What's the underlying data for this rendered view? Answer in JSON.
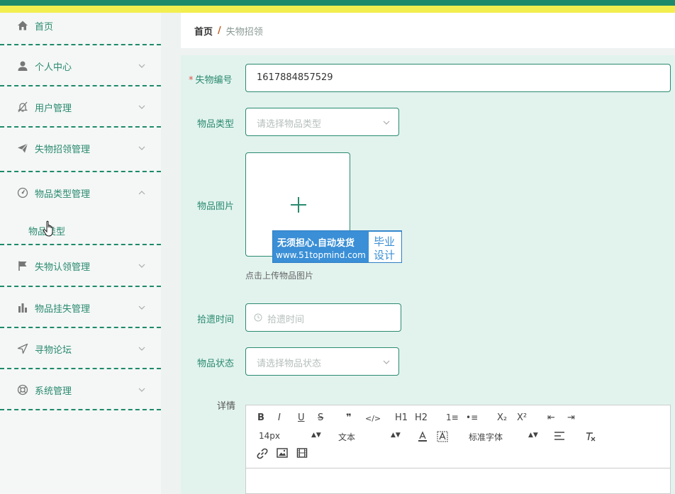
{
  "colors": {
    "primary": "#2a8a6f",
    "topbar_green": "#1e8a6a",
    "topbar_yellow": "#f2ee4f",
    "main_bg": "#e2f3ee",
    "required": "#e0534a",
    "watermark": "#3a8fd6"
  },
  "sidebar": {
    "items": [
      {
        "label": "首页",
        "icon": "home-icon"
      },
      {
        "label": "个人中心",
        "icon": "user-icon"
      },
      {
        "label": "用户管理",
        "icon": "bell-off-icon"
      },
      {
        "label": "失物招领管理",
        "icon": "send-icon"
      },
      {
        "label": "物品类型管理",
        "icon": "dashboard-icon"
      },
      {
        "label": "失物认领管理",
        "icon": "flag-icon"
      },
      {
        "label": "物品挂失管理",
        "icon": "bar-chart-icon"
      },
      {
        "label": "寻物论坛",
        "icon": "navigation-icon"
      },
      {
        "label": "系统管理",
        "icon": "lifebuoy-icon"
      }
    ],
    "submenu": {
      "label": "物品类型"
    }
  },
  "breadcrumb": {
    "home": "首页",
    "separator": "/",
    "current": "失物招领"
  },
  "form": {
    "lost_no": {
      "label": "失物编号",
      "value": "1617884857529"
    },
    "item_type": {
      "label": "物品类型",
      "placeholder": "请选择物品类型"
    },
    "item_image": {
      "label": "物品图片",
      "tip": "点击上传物品图片"
    },
    "found_time": {
      "label": "拾遗时间",
      "placeholder": "拾遗时间"
    },
    "item_status": {
      "label": "物品状态",
      "placeholder": "请选择物品状态"
    },
    "details": {
      "label": "详情"
    }
  },
  "editor": {
    "font_size": "14px",
    "header_select": "文本",
    "font_family": "标准字体",
    "buttons": [
      "B",
      "I",
      "U",
      "S",
      "❞",
      "</>",
      "H1",
      "H2",
      "1≡",
      "•≡",
      "X₂",
      "X²",
      "⇤",
      "⇥"
    ]
  },
  "watermark": {
    "line1": "无须担心.自动发货",
    "line2": "www.51topmind.com",
    "badge_top": "毕业",
    "badge_bottom": "设计"
  }
}
